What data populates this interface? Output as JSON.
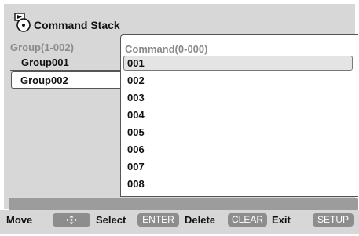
{
  "title": {
    "icon": "command-stack-icon",
    "text": "Command Stack"
  },
  "groups": {
    "header": "Group(1-002)",
    "items": [
      "Group001",
      "Group002"
    ],
    "selected_index": 1
  },
  "commands": {
    "header": "Command(0-000)",
    "items": [
      "001",
      "002",
      "003",
      "004",
      "005",
      "006",
      "007",
      "008"
    ],
    "highlighted_index": 0
  },
  "guide": {
    "move_label": "Move",
    "move_key_icon": "directional-arrows-icon",
    "select_label": "Select",
    "select_key": "ENTER",
    "delete_label": "Delete",
    "delete_key": "CLEAR",
    "exit_label": "Exit",
    "exit_key": "SETUP"
  },
  "colors": {
    "panel_bg": "#d7d7d7",
    "status_bar": "#9c9c9c",
    "key_bg": "#8d8d8d",
    "header_text": "#8a8a8a"
  }
}
